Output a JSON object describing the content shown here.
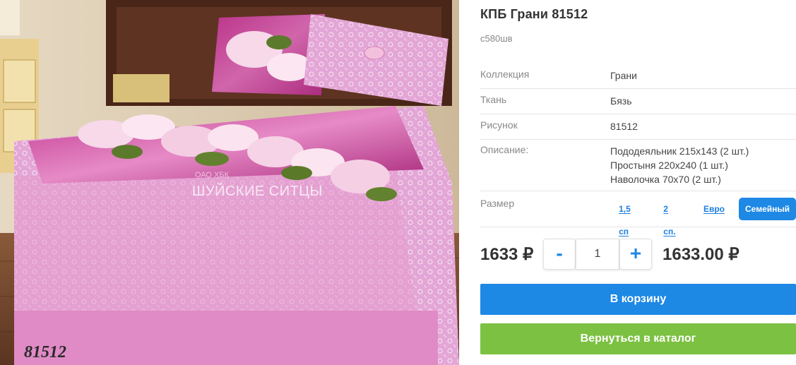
{
  "product": {
    "title": "КПБ Грани 81512",
    "sku": "c580шв",
    "image": {
      "code_label": "81512",
      "watermark_top": "ОАО ХБК",
      "watermark": "ШУЙСКИЕ СИТЦЫ"
    }
  },
  "properties": [
    {
      "label": "Коллекция",
      "value": "Грани"
    },
    {
      "label": "Ткань",
      "value": "Бязь"
    },
    {
      "label": "Рисунок",
      "value": "81512"
    }
  ],
  "description": {
    "label": "Описание:",
    "lines": [
      "Пододеяльник 215х143 (2 шт.)",
      "Простыня 220х240 (1 шт.)",
      "Наволочка 70х70 (2 шт.)"
    ]
  },
  "size": {
    "label": "Размер",
    "options": [
      "1,5 сп",
      "2 сп.",
      "Евро",
      "Семейный"
    ],
    "selected": "Семейный"
  },
  "pricing": {
    "unit_price": "1633 ₽",
    "minus_label": "-",
    "plus_label": "+",
    "quantity": "1",
    "total_price": "1633.00 ₽"
  },
  "actions": {
    "cart_label": "В корзину",
    "back_label": "Вернуться в каталог"
  },
  "colors": {
    "accent_blue": "#1e88e5",
    "green": "#7cc142",
    "bedding_pink": "#d77fbf"
  }
}
